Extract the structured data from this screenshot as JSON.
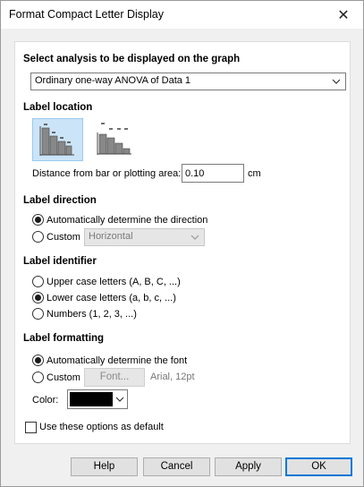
{
  "window": {
    "title": "Format Compact Letter Display",
    "close_glyph": "✕"
  },
  "analysis": {
    "heading": "Select analysis to be displayed on the graph",
    "selected": "Ordinary one-way ANOVA of Data 1"
  },
  "label_location": {
    "heading": "Label location",
    "options": [
      "on-bar-icon",
      "above-bar-icon"
    ],
    "selected_index": 0,
    "distance_label": "Distance from bar or plotting area:",
    "distance_value": "0.10",
    "distance_unit": "cm"
  },
  "label_direction": {
    "heading": "Label direction",
    "auto_label": "Automatically determine the direction",
    "custom_label": "Custom",
    "custom_value": "Horizontal",
    "selected": "auto"
  },
  "label_identifier": {
    "heading": "Label identifier",
    "options": [
      "Upper case letters (A, B, C, ...)",
      "Lower case letters (a, b, c, ...)",
      "Numbers (1, 2, 3, ...)"
    ],
    "selected_index": 1
  },
  "label_formatting": {
    "heading": "Label formatting",
    "auto_label": "Automatically determine the font",
    "custom_label": "Custom",
    "font_button": "Font...",
    "font_desc": "Arial, 12pt",
    "color_label": "Color:",
    "color_value": "#000000",
    "selected": "auto"
  },
  "default_option": {
    "label": "Use these options as default",
    "checked": false
  },
  "buttons": {
    "help": "Help",
    "cancel": "Cancel",
    "apply": "Apply",
    "ok": "OK"
  }
}
